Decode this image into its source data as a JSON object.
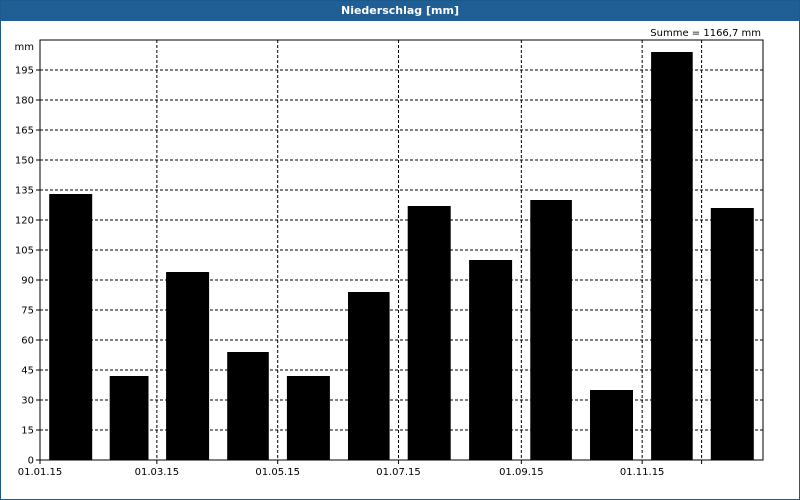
{
  "window": {
    "title": "Niederschlag [mm]"
  },
  "summary_text": "Summe = 1166,7 mm",
  "chart_data": {
    "type": "bar",
    "title": "Niederschlag [mm]",
    "ylabel": "mm",
    "xlabel": "",
    "ylim": [
      0,
      210
    ],
    "yticks": [
      0,
      15,
      30,
      45,
      60,
      75,
      90,
      105,
      120,
      135,
      150,
      165,
      180,
      195
    ],
    "categories": [
      "Jan 2015",
      "Feb 2015",
      "Mar 2015",
      "Apr 2015",
      "May 2015",
      "Jun 2015",
      "Jul 2015",
      "Aug 2015",
      "Sep 2015",
      "Oct 2015",
      "Nov 2015",
      "Dec 2015"
    ],
    "values": [
      133,
      42,
      94,
      54,
      42,
      84,
      127,
      100,
      130,
      35,
      204,
      126
    ],
    "xtick_labels": [
      "01.01.15",
      "01.03.15",
      "01.05.15",
      "01.07.15",
      "01.09.15",
      "01.11.15"
    ],
    "xtick_months": [
      0,
      2,
      4,
      6,
      8,
      10
    ],
    "grid": true,
    "bar_color": "#000000",
    "summary": "Summe = 1166,7 mm"
  },
  "colors": {
    "titlebar": "#1f5f95",
    "bar": "#000000",
    "grid": "#000000"
  }
}
